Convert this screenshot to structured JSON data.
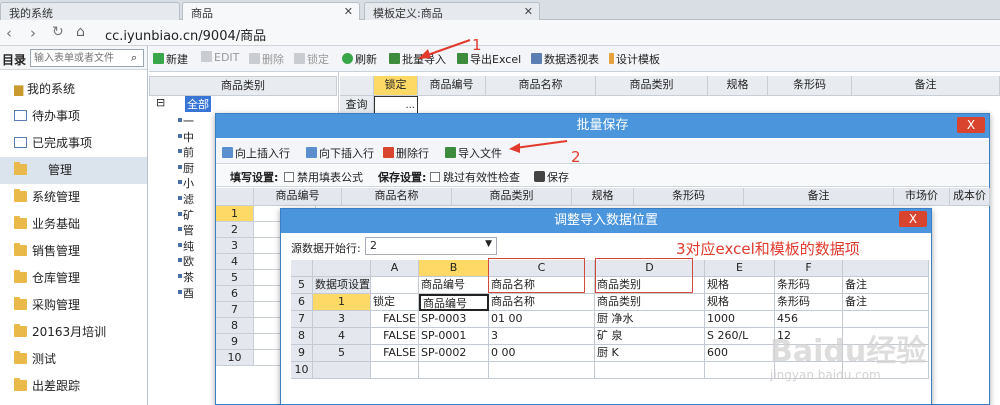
{
  "browser_tabs": [
    {
      "label": "我的系统"
    },
    {
      "label": "商品"
    },
    {
      "label": "模板定义:商品"
    }
  ],
  "url": "cc.iyunbiao.cn/9004/商品",
  "sidebar": {
    "title": "目录",
    "search_placeholder": "输入表单或者文件",
    "root": "我的系统",
    "items": [
      {
        "label": "待办事项",
        "icon": "doc"
      },
      {
        "label": "已完成事项",
        "icon": "doc"
      },
      {
        "label": "管理",
        "icon": "folder"
      },
      {
        "label": "系统管理",
        "icon": "folder"
      },
      {
        "label": "业务基础",
        "icon": "folder"
      },
      {
        "label": "销售管理",
        "icon": "folder"
      },
      {
        "label": "仓库管理",
        "icon": "folder"
      },
      {
        "label": "采购管理",
        "icon": "folder"
      },
      {
        "label": "20163月培训",
        "icon": "folder"
      },
      {
        "label": "测试",
        "icon": "folder"
      },
      {
        "label": "出差跟踪",
        "icon": "folder"
      }
    ]
  },
  "toolbar": {
    "new": "新建",
    "edit": "EDIT",
    "delete": "删除",
    "lock": "锁定",
    "refresh": "刷新",
    "batch_import": "批量导入",
    "export_excel": "导出Excel",
    "pivot": "数据透视表",
    "design": "设计模板"
  },
  "category": {
    "header": "商品类别",
    "root": "全部",
    "children": [
      "一",
      "中",
      "前",
      "厨",
      "小",
      "滤",
      "矿",
      "管",
      "纯",
      "欧",
      "茶",
      "酉"
    ]
  },
  "main_grid": {
    "headers": [
      "锁定",
      "商品编号",
      "商品名称",
      "商品类别",
      "规格",
      "条形码",
      "备注"
    ],
    "query_label": "查询",
    "ellipsis": "..."
  },
  "annotations": {
    "a1": "1",
    "a2": "2",
    "a3": "3对应excel和模板的数据项"
  },
  "dialog_batch": {
    "title": "批量保存",
    "close": "X",
    "tools": {
      "insert_up": "向上插入行",
      "insert_down": "向下插入行",
      "delete_row": "删除行",
      "import_file": "导入文件"
    },
    "settings": {
      "fill_label": "填写设置:",
      "disable_formula": "禁用填表公式",
      "save_label": "保存设置:",
      "skip_check": "跳过有效性检查",
      "save": "保存"
    },
    "headers": [
      "商品编号",
      "商品名称",
      "商品类别",
      "规格",
      "条形码",
      "备注",
      "市场价",
      "成本价"
    ],
    "row_numbers": [
      "1",
      "2",
      "3",
      "4",
      "5",
      "6",
      "7",
      "8",
      "9",
      "10"
    ]
  },
  "dialog_adjust": {
    "title": "调整导入数据位置",
    "close": "X",
    "start_row_label": "源数据开始行:",
    "start_row_value": "2",
    "col_letters": [
      "",
      "A",
      "B",
      "C",
      "D",
      "E",
      "F",
      ""
    ],
    "rows": [
      {
        "rn": "5",
        "cells": [
          "数据项设置",
          "",
          "商品编号",
          "商品名称",
          "商品类别",
          "规格",
          "条形码",
          "备注"
        ]
      },
      {
        "rn": "6",
        "cells": [
          "1",
          "锁定",
          "商品编号",
          "商品名称",
          "商品类别",
          "规格",
          "条形码",
          "备注"
        ]
      },
      {
        "rn": "7",
        "cells": [
          "3",
          "FALSE",
          "SP-0003",
          "01  00",
          "厨  净水",
          "1000",
          "456",
          ""
        ]
      },
      {
        "rn": "8",
        "cells": [
          "4",
          "FALSE",
          "SP-0001",
          "3",
          "矿  泉",
          "S  260/L",
          "12",
          ""
        ]
      },
      {
        "rn": "9",
        "cells": [
          "5",
          "FALSE",
          "SP-0002",
          "0  00",
          "厨  K",
          "600",
          "",
          ""
        ]
      },
      {
        "rn": "10",
        "cells": [
          "",
          "",
          "",
          "",
          "",
          "",
          "",
          ""
        ]
      }
    ]
  },
  "watermark": {
    "brand": "Baidu经验",
    "site": "jingyan.baidu.com"
  },
  "colors": {
    "accent": "#4a95dc",
    "annotation": "#e03b2d",
    "selected_col": "#ffd966"
  }
}
